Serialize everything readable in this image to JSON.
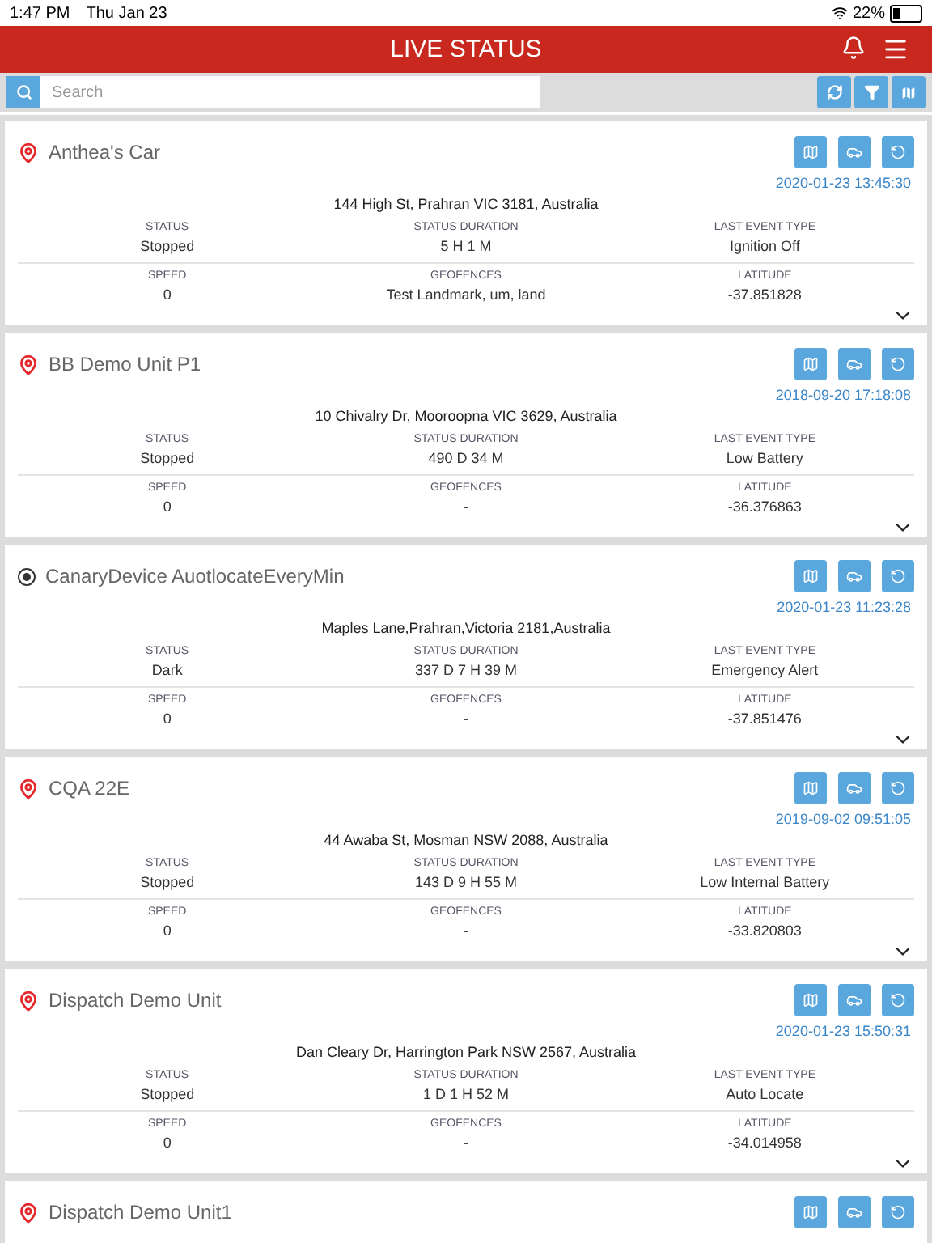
{
  "status_bar": {
    "time": "1:47 PM",
    "date": "Thu Jan 23",
    "battery": "22%"
  },
  "header": {
    "title": "LIVE STATUS"
  },
  "search": {
    "placeholder": "Search"
  },
  "units": [
    {
      "name": "Anthea's Car",
      "kind": "pin",
      "timestamp": "2020-01-23 13:45:30",
      "address": "144 High St, Prahran VIC 3181, Australia",
      "rows": [
        [
          {
            "label": "STATUS",
            "value": "Stopped"
          },
          {
            "label": "STATUS DURATION",
            "value": "5 H 1 M"
          },
          {
            "label": "LAST EVENT TYPE",
            "value": "Ignition Off"
          }
        ],
        [
          {
            "label": "SPEED",
            "value": "0"
          },
          {
            "label": "GEOFENCES",
            "value": "Test Landmark, um, land"
          },
          {
            "label": "LATITUDE",
            "value": "-37.851828"
          }
        ]
      ]
    },
    {
      "name": "BB Demo Unit P1",
      "kind": "pin",
      "timestamp": "2018-09-20 17:18:08",
      "address": "10 Chivalry Dr, Mooroopna VIC 3629, Australia",
      "rows": [
        [
          {
            "label": "STATUS",
            "value": "Stopped"
          },
          {
            "label": "STATUS DURATION",
            "value": "490 D 34 M"
          },
          {
            "label": "LAST EVENT TYPE",
            "value": "Low Battery"
          }
        ],
        [
          {
            "label": "SPEED",
            "value": "0"
          },
          {
            "label": "GEOFENCES",
            "value": "-"
          },
          {
            "label": "LATITUDE",
            "value": "-36.376863"
          }
        ]
      ]
    },
    {
      "name": "CanaryDevice AuotlocateEveryMin",
      "kind": "target",
      "timestamp": "2020-01-23 11:23:28",
      "address": "Maples Lane,Prahran,Victoria 2181,Australia",
      "rows": [
        [
          {
            "label": "STATUS",
            "value": "Dark"
          },
          {
            "label": "STATUS DURATION",
            "value": "337 D 7 H 39 M"
          },
          {
            "label": "LAST EVENT TYPE",
            "value": "Emergency Alert"
          }
        ],
        [
          {
            "label": "SPEED",
            "value": "0"
          },
          {
            "label": "GEOFENCES",
            "value": "-"
          },
          {
            "label": "LATITUDE",
            "value": "-37.851476"
          }
        ]
      ]
    },
    {
      "name": "CQA 22E",
      "kind": "pin",
      "timestamp": "2019-09-02 09:51:05",
      "address": "44 Awaba St, Mosman NSW 2088, Australia",
      "rows": [
        [
          {
            "label": "STATUS",
            "value": "Stopped"
          },
          {
            "label": "STATUS DURATION",
            "value": "143 D 9 H 55 M"
          },
          {
            "label": "LAST EVENT TYPE",
            "value": "Low Internal Battery"
          }
        ],
        [
          {
            "label": "SPEED",
            "value": "0"
          },
          {
            "label": "GEOFENCES",
            "value": "-"
          },
          {
            "label": "LATITUDE",
            "value": "-33.820803"
          }
        ]
      ]
    },
    {
      "name": "Dispatch Demo Unit",
      "kind": "pin",
      "timestamp": "2020-01-23 15:50:31",
      "address": "Dan Cleary Dr, Harrington Park NSW 2567, Australia",
      "rows": [
        [
          {
            "label": "STATUS",
            "value": "Stopped"
          },
          {
            "label": "STATUS DURATION",
            "value": "1 D 1 H 52 M"
          },
          {
            "label": "LAST EVENT TYPE",
            "value": "Auto Locate"
          }
        ],
        [
          {
            "label": "SPEED",
            "value": "0"
          },
          {
            "label": "GEOFENCES",
            "value": "-"
          },
          {
            "label": "LATITUDE",
            "value": "-34.014958"
          }
        ]
      ]
    },
    {
      "name": "Dispatch Demo Unit1",
      "kind": "pin"
    }
  ]
}
